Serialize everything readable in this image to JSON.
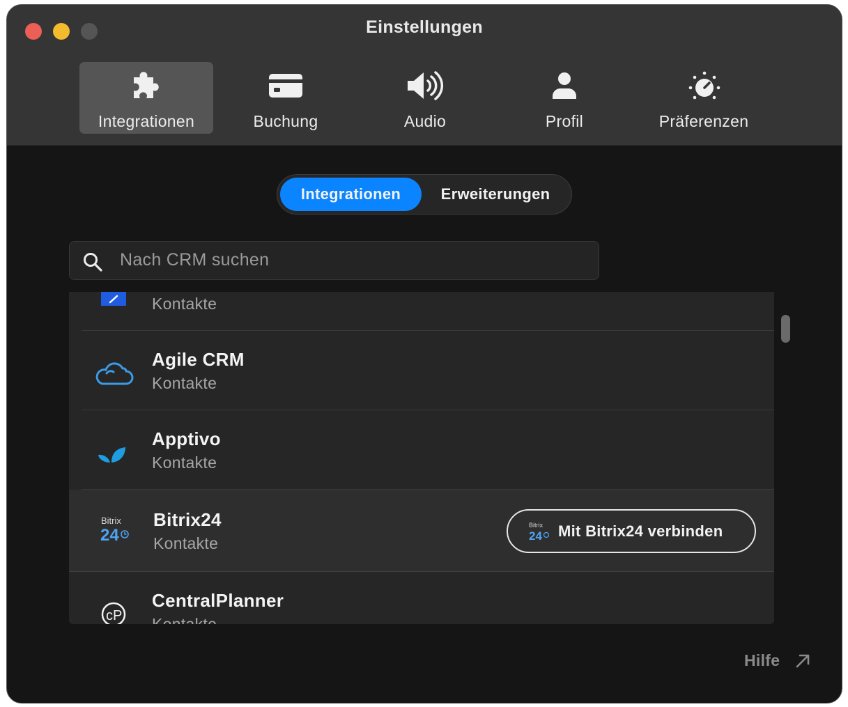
{
  "window": {
    "title": "Einstellungen"
  },
  "toolbar": {
    "tabs": [
      {
        "label": "Integrationen",
        "icon": "puzzle-icon",
        "active": true
      },
      {
        "label": "Buchung",
        "icon": "credit-card-icon",
        "active": false
      },
      {
        "label": "Audio",
        "icon": "speaker-icon",
        "active": false
      },
      {
        "label": "Profil",
        "icon": "person-icon",
        "active": false
      },
      {
        "label": "Präferenzen",
        "icon": "dial-icon",
        "active": false
      }
    ]
  },
  "segmented": {
    "options": [
      {
        "label": "Integrationen",
        "selected": true
      },
      {
        "label": "Erweiterungen",
        "selected": false
      }
    ]
  },
  "search": {
    "placeholder": "Nach CRM suchen",
    "value": ""
  },
  "crm_list": {
    "items": [
      {
        "name": "",
        "subtitle": "Kontakte",
        "logo": "blue-square-logo-icon"
      },
      {
        "name": "Agile CRM",
        "subtitle": "Kontakte",
        "logo": "cloud-icon"
      },
      {
        "name": "Apptivo",
        "subtitle": "Kontakte",
        "logo": "leaf-icon"
      },
      {
        "name": "Bitrix24",
        "subtitle": "Kontakte",
        "logo": "bitrix24-logo-icon",
        "connect_label": "Mit Bitrix24 verbinden"
      },
      {
        "name": "CentralPlanner",
        "subtitle": "Kontakte",
        "logo": "centralplanner-logo-icon"
      }
    ]
  },
  "help": {
    "label": "Hilfe",
    "icon": "arrow-up-right-icon"
  },
  "colors": {
    "accent": "#0a84ff",
    "window_bg": "#151515",
    "titlebar_bg": "#353535",
    "list_bg": "#262626"
  }
}
